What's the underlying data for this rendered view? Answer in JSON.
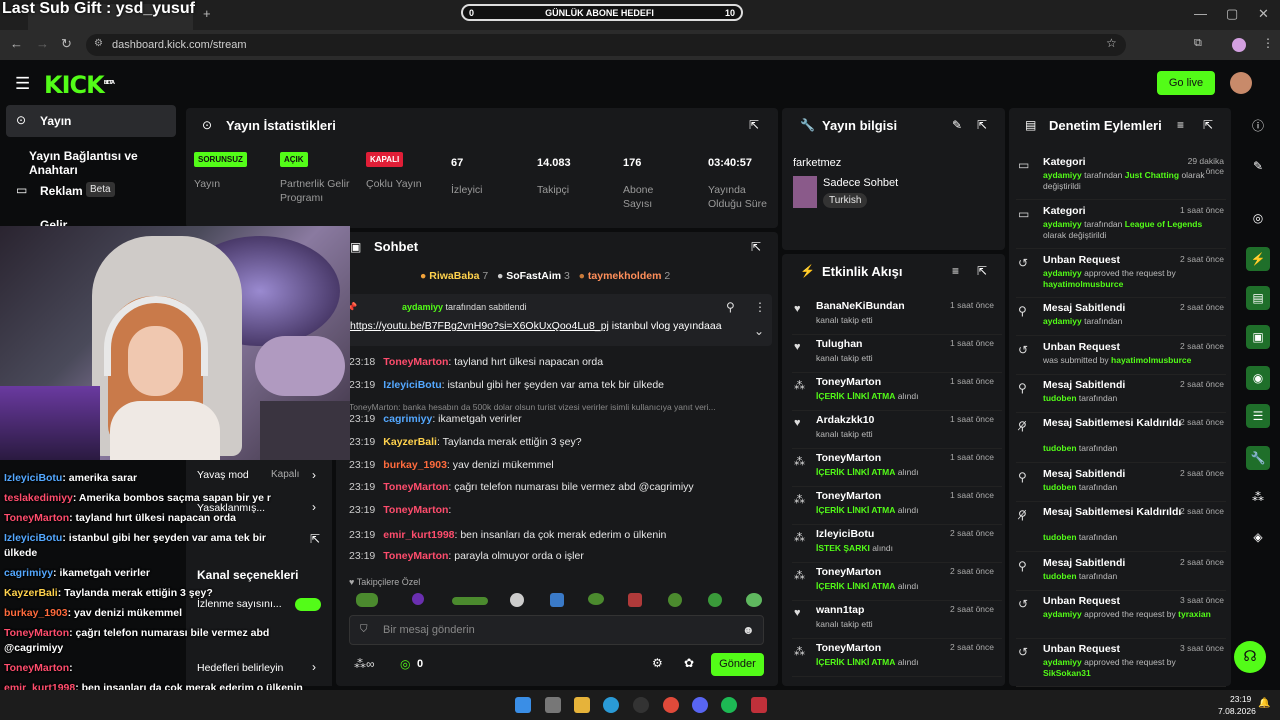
{
  "overlay": {
    "title": "Last Sub Gift : ysd_yusuf",
    "goal_left": "0",
    "goal_label": "GÜNLÜK ABONE HEDEFI",
    "goal_right": "10"
  },
  "browser": {
    "url": "dashboard.kick.com/stream",
    "window_min": "—",
    "window_max": "▢",
    "window_close": "✕"
  },
  "app": {
    "logo": "KICK",
    "logo_beta": "BETA",
    "go_live": "Go live"
  },
  "sidebar": {
    "items": [
      {
        "label": "Yayın"
      },
      {
        "label": "Yayın Bağlantısı ve Anahtarı"
      },
      {
        "label": "Reklam",
        "badge": "Beta"
      },
      {
        "label": "Gelir"
      }
    ]
  },
  "stats": {
    "title": "Yayın İstatistikleri",
    "items": [
      {
        "badge": "SORUNSUZ",
        "label": "Yayın"
      },
      {
        "badge": "AÇIK",
        "label": "Partnerlik Gelir Programı"
      },
      {
        "badge": "KAPALI",
        "label": "Çoklu Yayın"
      },
      {
        "value": "67",
        "label": "İzleyici"
      },
      {
        "value": "14.083",
        "label": "Takipçi"
      },
      {
        "value": "176",
        "label": "Abone Sayısı"
      },
      {
        "value": "03:40:57",
        "label": "Yayında Olduğu Süre"
      }
    ]
  },
  "info": {
    "title": "Yayın bilgisi",
    "stream_title": "farketmez",
    "category": "Sadece Sohbet",
    "tag": "Turkish"
  },
  "chat": {
    "title": "Sohbet",
    "top": [
      {
        "name": "RiwaBaba",
        "count": "7"
      },
      {
        "name": "SoFastAim",
        "count": "3"
      },
      {
        "name": "taymekholdem",
        "count": "2"
      }
    ],
    "pinned_by": "aydamiyy",
    "pinned_suffix": "tarafından sabitlendi",
    "pinned_link": "https://youtu.be/B7FBg2vnH9o?si=X6OkUxQoo4Lu8_pj",
    "pinned_text": " istanbul vlog yayındaaa",
    "messages": [
      {
        "time": "23:18",
        "user": "ToneyMarton",
        "text": ": tayland hırt ülkesi napacan orda"
      },
      {
        "time": "23:19",
        "user": "IzleyiciBotu",
        "text": ": istanbul gibi her şeyden var ama tek bir ülkede"
      },
      {
        "reply": "ToneyMarton: banka hesabın da 500k dolar olsun turist vizesi verirler isimli kullanıcıya yanıt veri..."
      },
      {
        "time": "23:19",
        "user": "cagrimiyy",
        "text": ": ikametgah verirler"
      },
      {
        "time": "23:19",
        "user": "KayzerBali",
        "text": ": Taylanda merak ettiğin 3 şey?"
      },
      {
        "time": "23:19",
        "user": "burkay_1903",
        "text": ": yav denizi mükemmel"
      },
      {
        "time": "23:19",
        "user": "ToneyMarton",
        "text": ": çağrı telefon numarası bile vermez abd @cagrimiyy"
      },
      {
        "time": "23:19",
        "user": "ToneyMarton",
        "text": ":"
      },
      {
        "time": "23:19",
        "user": "emir_kurt1998",
        "text": ": ben insanları da çok merak ederim o ülkenin"
      },
      {
        "time": "23:19",
        "user": "ToneyMarton",
        "text": ": parayla olmuyor orda o işler"
      }
    ],
    "followers_only": "Takipçilere Özel",
    "placeholder": "Bir mesaj gönderin",
    "count": "0",
    "send": "Gönder"
  },
  "events": {
    "title": "Etkinlik Akışı",
    "items": [
      {
        "name": "BanaNeKiBundan",
        "desc": "kanalı takip etti",
        "time": "1 saat önce"
      },
      {
        "name": "Tulughan",
        "desc": "kanalı takip etti",
        "time": "1 saat önce"
      },
      {
        "name": "ToneyMarton",
        "desc_hl": "İÇERİK LİNKİ ATMA",
        "desc": " alındı",
        "time": "1 saat önce"
      },
      {
        "name": "Ardakzkk10",
        "desc": "kanalı takip etti",
        "time": "1 saat önce"
      },
      {
        "name": "ToneyMarton",
        "desc_hl": "İÇERİK LİNKİ ATMA",
        "desc": " alındı",
        "time": "1 saat önce"
      },
      {
        "name": "ToneyMarton",
        "desc_hl": "İÇERİK LİNKİ ATMA",
        "desc": " alındı",
        "time": "1 saat önce"
      },
      {
        "name": "IzleyiciBotu",
        "desc_hl": "İSTEK ŞARKI",
        "desc": " alındı",
        "time": "2 saat önce"
      },
      {
        "name": "ToneyMarton",
        "desc_hl": "İÇERİK LİNKİ ATMA",
        "desc": " alındı",
        "time": "2 saat önce"
      },
      {
        "name": "wann1tap",
        "desc": "kanalı takip etti",
        "time": "2 saat önce"
      },
      {
        "name": "ToneyMarton",
        "desc_hl": "İÇERİK LİNKİ ATMA",
        "desc": " alındı",
        "time": "2 saat önce"
      }
    ]
  },
  "moderation": {
    "title": "Denetim Eylemleri",
    "items": [
      {
        "name": "Kategori",
        "time": "29 dakika önce",
        "actor": "aydamiyy",
        "mid": " tarafından ",
        "hl": "Just Chatting",
        "tail": " olarak değiştirildi"
      },
      {
        "name": "Kategori",
        "time": "1 saat önce",
        "actor": "aydamiyy",
        "mid": " tarafından ",
        "hl": "League of Legends",
        "tail": " olarak değiştirildi"
      },
      {
        "name": "Unban Request",
        "time": "2 saat önce",
        "actor": "aydamiyy",
        "mid": " approved the request by ",
        "hl": "hayatimolmusburce",
        "tail": ""
      },
      {
        "name": "Mesaj Sabitlendi",
        "time": "2 saat önce",
        "actor": "aydamiyy",
        "mid": " tarafından",
        "hl": "",
        "tail": ""
      },
      {
        "name": "Unban Request",
        "time": "2 saat önce",
        "actor": "",
        "mid": "was submitted by ",
        "hl": "hayatimolmusburce",
        "tail": ""
      },
      {
        "name": "Mesaj Sabitlendi",
        "time": "2 saat önce",
        "actor": "tudoben",
        "mid": " tarafından",
        "hl": "",
        "tail": ""
      },
      {
        "name": "Mesaj Sabitlemesi Kaldırıldı",
        "time": "2 saat önce",
        "actor": "tudoben",
        "mid": " tarafından",
        "hl": "",
        "tail": ""
      },
      {
        "name": "Mesaj Sabitlendi",
        "time": "2 saat önce",
        "actor": "tudoben",
        "mid": " tarafından",
        "hl": "",
        "tail": ""
      },
      {
        "name": "Mesaj Sabitlemesi Kaldırıldı",
        "time": "2 saat önce",
        "actor": "tudoben",
        "mid": " tarafından",
        "hl": "",
        "tail": ""
      },
      {
        "name": "Mesaj Sabitlendi",
        "time": "2 saat önce",
        "actor": "tudoben",
        "mid": " tarafından",
        "hl": "",
        "tail": ""
      },
      {
        "name": "Unban Request",
        "time": "3 saat önce",
        "actor": "aydamiyy",
        "mid": " approved the request by ",
        "hl": "tyraxian",
        "tail": ""
      },
      {
        "name": "Unban Request",
        "time": "3 saat önce",
        "actor": "aydamiyy",
        "mid": " approved the request by ",
        "hl": "SikSokan31",
        "tail": ""
      }
    ]
  },
  "settings": {
    "slow_mode": "Yavaş mod",
    "slow_mode_value": "Kapalı",
    "banned": "Yasaklanmış...",
    "channel_options": "Kanal seçenekleri",
    "watch_perm": "İzlenme sayısını...",
    "goals": "Hedefleri belirleyin"
  },
  "overlay_chat": [
    {
      "user": "IzleyiciBotu",
      "text": ": amerika sarar",
      "color": "#54a8ff"
    },
    {
      "user": "teslakedimiyy",
      "text": ": Amerika bombos saçma sapan bir ye r",
      "color": "#ff4d6d"
    },
    {
      "user": "ToneyMarton",
      "text": ": tayland hırt ülkesi napacan orda",
      "color": "#ff4d6d"
    },
    {
      "user": "IzleyiciBotu",
      "text": ": istanbul gibi her şeyden var ama tek bir",
      "color": "#54a8ff"
    },
    {
      "user": "",
      "text": "ülkede",
      "color": "#fff"
    },
    {
      "user": "cagrimiyy",
      "text": ": ikametgah verirler",
      "color": "#54a8ff"
    },
    {
      "user": "KayzerBali",
      "text": ": Taylanda merak ettiğin 3 şey?",
      "color": "#ffd24d"
    },
    {
      "user": "burkay_1903",
      "text": ": yav denizi mükemmel",
      "color": "#ff6b3d"
    },
    {
      "user": "ToneyMarton",
      "text": ": çağrı telefon numarası bile vermez abd",
      "color": "#ff4d6d"
    },
    {
      "user": "",
      "text": "@cagrimiyy",
      "color": "#fff"
    },
    {
      "user": "ToneyMarton",
      "text": ":",
      "color": "#ff4d6d"
    },
    {
      "user": "emir_kurt1998",
      "text": ": ben insanları da çok merak ederim o ülkenin",
      "color": "#ff4d6d"
    },
    {
      "user": "ToneyMarton",
      "text": ": parayla olmuyor orda o işler",
      "color": "#ff4d6d"
    }
  ],
  "taskbar": {
    "time": "23:19",
    "date": "7.08.2026"
  },
  "colors": {
    "accent": "#53fc18",
    "panel": "#18191b",
    "bg": "#0b0c0d"
  }
}
